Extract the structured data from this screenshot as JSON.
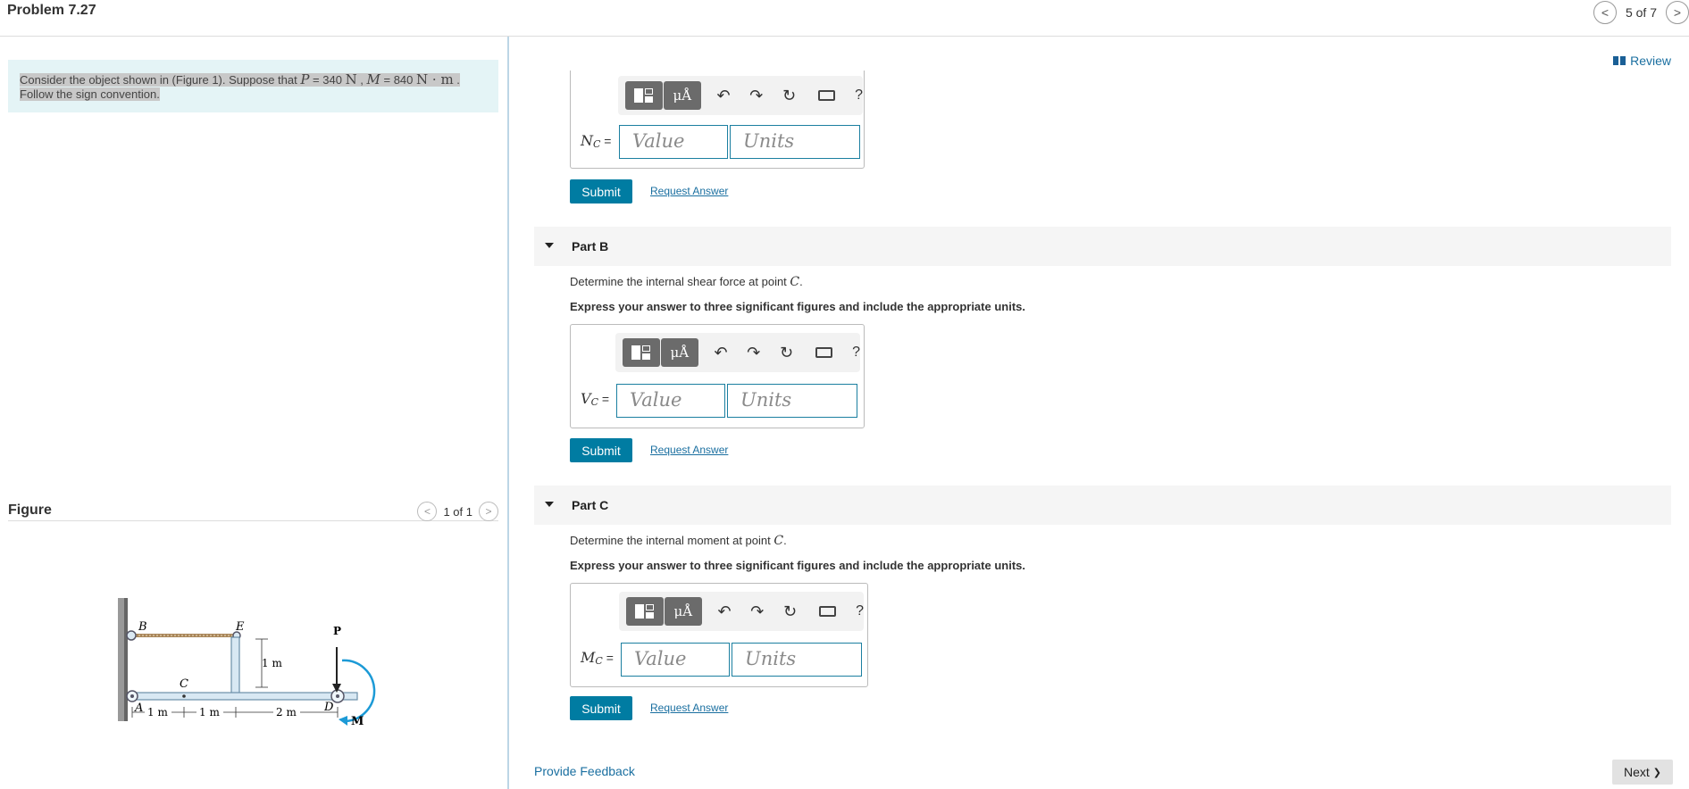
{
  "header": {
    "problem_title": "Problem 7.27",
    "pager_count": "5 of 7",
    "prev_glyph": "<",
    "next_glyph": ">"
  },
  "problem": {
    "text_1": "Consider the object shown in (Figure 1). Suppose that ",
    "p_sym": "P",
    "p_eq": " = 340 ",
    "p_unit": "N",
    "sep": " , ",
    "m_sym": "M",
    "m_eq": " = 840 ",
    "m_unit": "N · m",
    "end": " .",
    "text_2": "Follow the sign convention."
  },
  "figure": {
    "title": "Figure",
    "count": "1 of 1",
    "prev_glyph": "<",
    "next_glyph": ">",
    "labels": {
      "B": "B",
      "E": "E",
      "P": "P",
      "C": "C",
      "A": "A",
      "D": "D",
      "M": "M",
      "height": "1 m",
      "d1": "1 m",
      "d2": "1 m",
      "d3": "2 m"
    }
  },
  "review": {
    "label": "Review"
  },
  "toolbar": {
    "mu_label": "μÅ",
    "help": "?"
  },
  "inputs": {
    "value_placeholder": "Value",
    "units_placeholder": "Units"
  },
  "buttons": {
    "submit": "Submit",
    "request_answer": "Request Answer"
  },
  "part_a": {
    "var_main": "N",
    "var_sub": "C",
    "eq": " ="
  },
  "part_b": {
    "label": "Part B",
    "question_text": "Determine the internal shear force at point ",
    "question_point": "C",
    "question_end": ".",
    "instruction": "Express your answer to three significant figures and include the appropriate units.",
    "var_main": "V",
    "var_sub": "C",
    "eq": " ="
  },
  "part_c": {
    "label": "Part C",
    "question_text": "Determine the internal moment at point ",
    "question_point": "C",
    "question_end": ".",
    "instruction": "Express your answer to three significant figures and include the appropriate units.",
    "var_main": "M",
    "var_sub": "C",
    "eq": " ="
  },
  "footer": {
    "feedback": "Provide Feedback",
    "next": "Next",
    "next_glyph": "❯"
  }
}
